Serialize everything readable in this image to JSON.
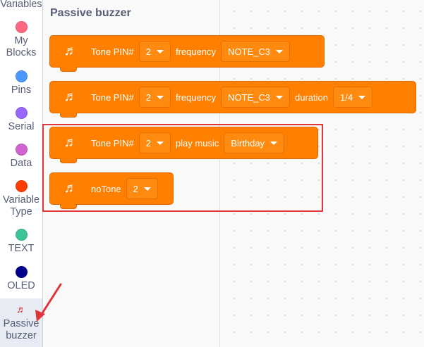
{
  "sidebar": {
    "categories": [
      {
        "label": "Variables",
        "color": ""
      },
      {
        "label": "My\nBlocks",
        "color": "#ff6680"
      },
      {
        "label": "Pins",
        "color": "#4c97ff"
      },
      {
        "label": "Serial",
        "color": "#9966ff"
      },
      {
        "label": "Data",
        "color": "#cf63cf"
      },
      {
        "label": "Variable\nType",
        "color": "#ff3d00"
      },
      {
        "label": "TEXT",
        "color": "#3cc39a"
      },
      {
        "label": "OLED",
        "color": "#00008b"
      },
      {
        "label": "Passive\nbuzzer",
        "color": "#ff3333",
        "icon": "music-note-icon"
      }
    ]
  },
  "flyout": {
    "title": "Passive buzzer",
    "blocks": [
      {
        "icon": "music-note-icon",
        "parts": [
          "Tone PIN#",
          "2",
          "frequency",
          "NOTE_C3"
        ]
      },
      {
        "icon": "music-note-icon",
        "parts": [
          "Tone PIN#",
          "2",
          "frequency",
          "NOTE_C3",
          "duration",
          "1/4"
        ]
      },
      {
        "icon": "music-note-icon",
        "parts": [
          "Tone PIN#",
          "2",
          "play music",
          "Birthday"
        ]
      },
      {
        "icon": "music-note-icon",
        "parts": [
          "noTone",
          "2"
        ]
      }
    ]
  },
  "colors": {
    "block_fill": "#ff7f00",
    "highlight": "#e0353b"
  }
}
